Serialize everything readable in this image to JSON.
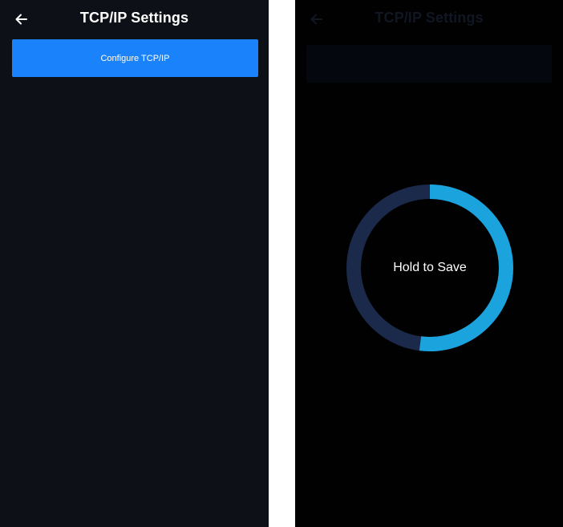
{
  "left_screen": {
    "header": {
      "title": "TCP/IP Settings",
      "back_icon": "arrow-left-icon"
    },
    "configure_button_label": "Configure TCP/IP",
    "colors": {
      "background": "#0d1117",
      "accent": "#1a82fb"
    }
  },
  "right_screen": {
    "header": {
      "title": "TCP/IP Settings",
      "back_icon": "arrow-left-icon"
    },
    "hold_button": {
      "label": "Hold to Save",
      "progress": 0.52,
      "progress_color": "#1aa3dc",
      "track_color": "#1b2a4a"
    },
    "colors": {
      "background": "#010101"
    }
  }
}
